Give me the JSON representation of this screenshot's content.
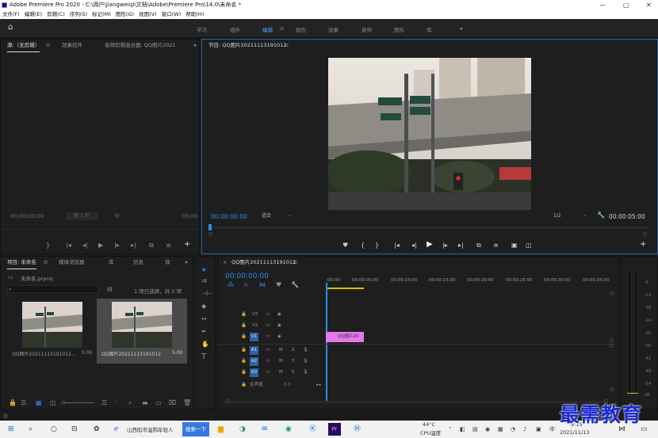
{
  "window": {
    "title": "Adobe Premiere Pro 2020 - C:\\用户\\jiangweiqi\\文档\\Adobe\\Premiere Pro\\14.0\\未命名 *"
  },
  "menu": [
    "文件(F)",
    "编辑(E)",
    "剪辑(C)",
    "序列(S)",
    "标记(M)",
    "图形(G)",
    "视图(V)",
    "窗口(W)",
    "帮助(H)"
  ],
  "workspaces": [
    "学习",
    "组件",
    "编辑",
    "颜色",
    "效果",
    "音频",
    "图形",
    "库"
  ],
  "source": {
    "tabs": [
      "源:（无剪辑）",
      "效果控件",
      "音频剪辑混合器: QQ图片2021"
    ],
    "timecode": "00;00;00;00",
    "timecode_right": "00;00",
    "page": "第 1 页"
  },
  "program": {
    "title": "节目: QQ图片20211113191012",
    "timecode": "00:00:00:00",
    "fit": "适合",
    "ratio": "1/2",
    "duration": "00:00:05:00"
  },
  "project": {
    "tabs": [
      "项目: 未命名",
      "媒体浏览器",
      "库",
      "信息",
      "效"
    ],
    "file": "未命名.prproj",
    "status": "1 项已选择，共 2 项",
    "items": [
      {
        "name": "QQ图片20211113191012...",
        "duration": "5:00"
      },
      {
        "name": "QQ图片20211113191012",
        "duration": "5:00"
      }
    ]
  },
  "timeline": {
    "title": "QQ图片20211113191012",
    "timecode": "00:00:00:00",
    "ruler": [
      ":00:00",
      "00:00:05:00",
      "00:00:10:00",
      "00:00:15:00",
      "00:00:20:00",
      "00:00:25:00",
      "00:00:30:00",
      "00:00:35:00"
    ],
    "video_tracks": [
      "V3",
      "V2",
      "V1"
    ],
    "audio_tracks": [
      "A1",
      "A2",
      "A3"
    ],
    "master": "主声道",
    "master_value": "0.0",
    "clip": "QQ图片20"
  },
  "meter": {
    "labels": [
      "-6",
      "-12",
      "-18",
      "-24",
      "-30",
      "-36",
      "-42",
      "-48",
      "-54",
      "dB"
    ]
  },
  "taskbar": {
    "search": "山西陷市温购年轻人",
    "search_btn": "搜索一下",
    "weather_temp": "44°C",
    "weather_label": "CPU温度",
    "ime": "中",
    "time": "9:15",
    "date": "2021/11/13"
  },
  "watermark": "最需教育",
  "colors": {
    "accent": "#2d8ceb",
    "clip": "#e27be8",
    "track_blue": "#2d62a3"
  }
}
